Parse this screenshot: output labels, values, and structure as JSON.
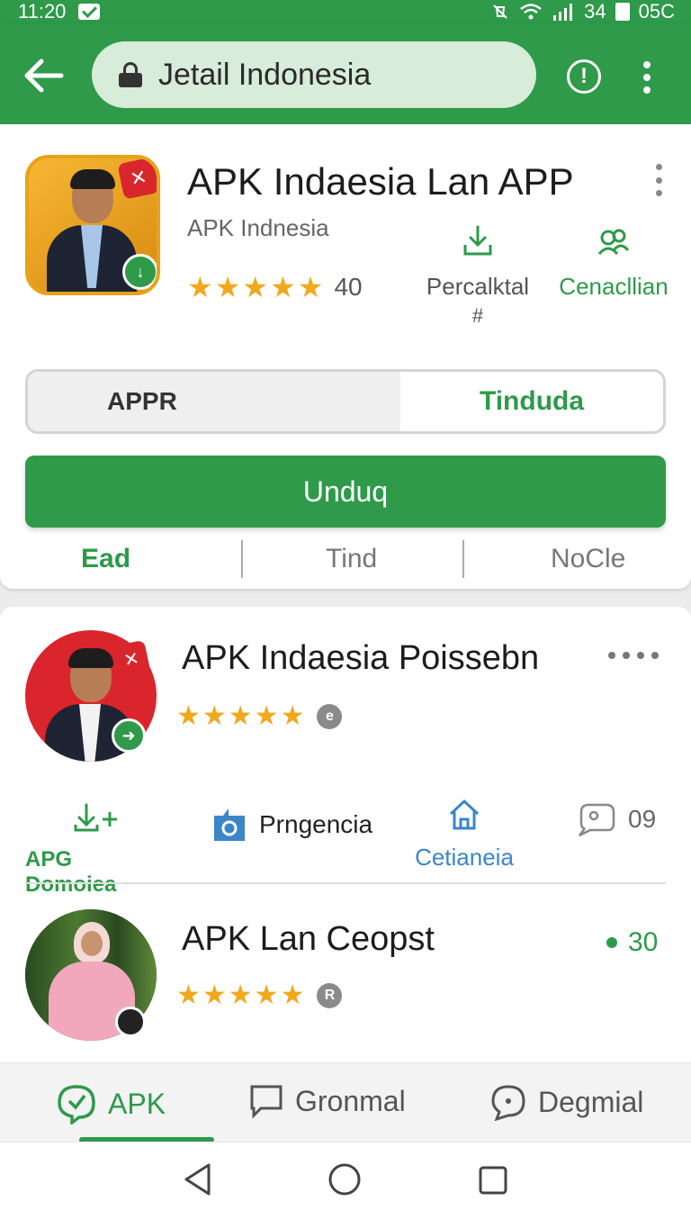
{
  "status_bar": {
    "time": "11:20",
    "battery_text": "34",
    "carrier": "05C"
  },
  "app_bar": {
    "url_text": "Jetail Indonesia"
  },
  "featured": {
    "title": "APK Indaesia Lan APP",
    "subtitle": "APK Indnesia",
    "stars": "★★★★★",
    "rating": "40",
    "stat1_label": "Percalktal",
    "stat1_sub": "#",
    "stat2_label": "Cenacllian",
    "segment_left": "APPR",
    "segment_right": "Tinduda",
    "install_label": "Unduq",
    "tabs": [
      "Ead",
      "Tind",
      "NoCle"
    ]
  },
  "list": [
    {
      "title": "APK Indaesia Poissebn",
      "stars": "★★★★★",
      "badge": "e",
      "actions": {
        "a1_label": "APG Domoiea",
        "a2_label": "Prngencia",
        "a3_label": "Cetianeia",
        "a4_value": "09"
      }
    },
    {
      "title": "APK Lan Ceopst",
      "stars": "★★★★★",
      "badge": "R",
      "count": "30"
    }
  ],
  "bottom_nav": {
    "tab1": "APK",
    "tab2": "Gronmal",
    "tab3": "Degmial"
  },
  "colors": {
    "primary": "#2e9a4a",
    "star": "#f2a81d",
    "link_blue": "#3a86c8"
  }
}
